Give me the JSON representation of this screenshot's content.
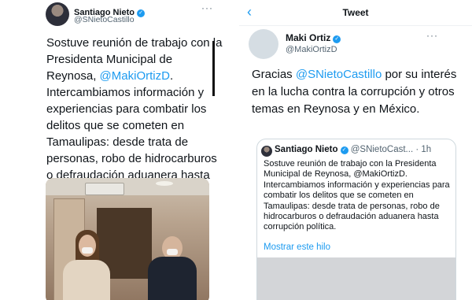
{
  "left_tweet": {
    "author_name": "Santiago Nieto",
    "author_handle": "@SNietoCastillo",
    "more_label": "···",
    "text_part1": "Sostuve reunión de trabajo con la Presidenta Municipal de Reynosa, ",
    "mention": "@MakiOrtizD",
    "text_part2": ". Intercambiamos información y experiencias para combatir los delitos que se cometen en Tamaulipas: desde trata de personas, robo de hidrocarburos o defraudación aduanera hasta corrupción política."
  },
  "right_screen": {
    "title": "Tweet",
    "back_icon": "chevron-left-icon",
    "author_name": "Maki Ortiz",
    "author_handle": "@MakiOrtizD",
    "more_label": "···",
    "text_part1": "Gracias ",
    "mention": "@SNietoCastillo",
    "text_part2": "  por su interés en la lucha contra la corrupción y otros temas en Reynosa y en México.",
    "quoted_tweet": {
      "author_name": "Santiago Nieto",
      "author_handle": "@SNietoCast...",
      "dot": "·",
      "time": "1h",
      "text": "Sostuve reunión de trabajo con la Presidenta Municipal de Reynosa, @MakiOrtizD. Intercambiamos información y experiencias para combatir los delitos que se cometen en Tamaulipas: desde trata de personas, robo de hidrocarburos o defraudación aduanera hasta corrupción política.",
      "thread_link": "Mostrar este hilo"
    }
  },
  "colors": {
    "accent": "#1d9bf0",
    "text": "#0f1419",
    "muted": "#536471"
  }
}
